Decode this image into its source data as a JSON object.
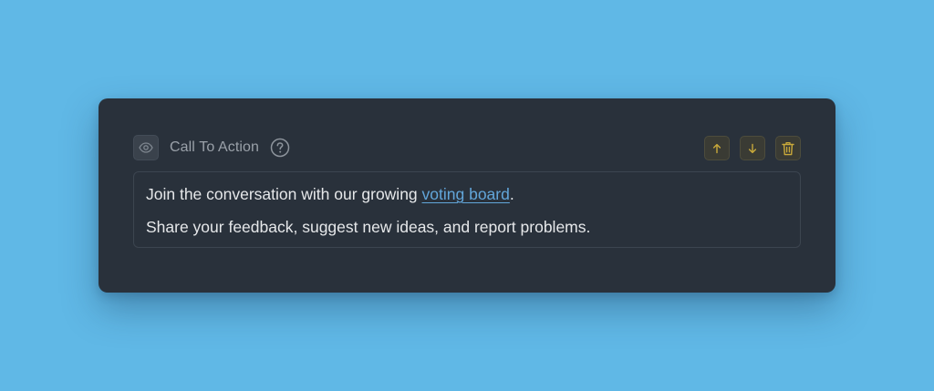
{
  "block": {
    "title": "Call To Action",
    "visibility_icon": "eye-icon",
    "help_icon": "question-circle-icon",
    "actions": {
      "move_up_icon": "arrow-up-icon",
      "move_down_icon": "arrow-down-icon",
      "delete_icon": "trash-icon"
    },
    "content": {
      "line1_before": "Join the conversation with our growing ",
      "line1_link": "voting board",
      "line1_after": ".",
      "line2": "Share your feedback, suggest new ideas, and report problems."
    }
  },
  "colors": {
    "background": "#60b8e6",
    "card": "#29313b",
    "link": "#62a6da",
    "action_icon": "#c9a93a"
  }
}
